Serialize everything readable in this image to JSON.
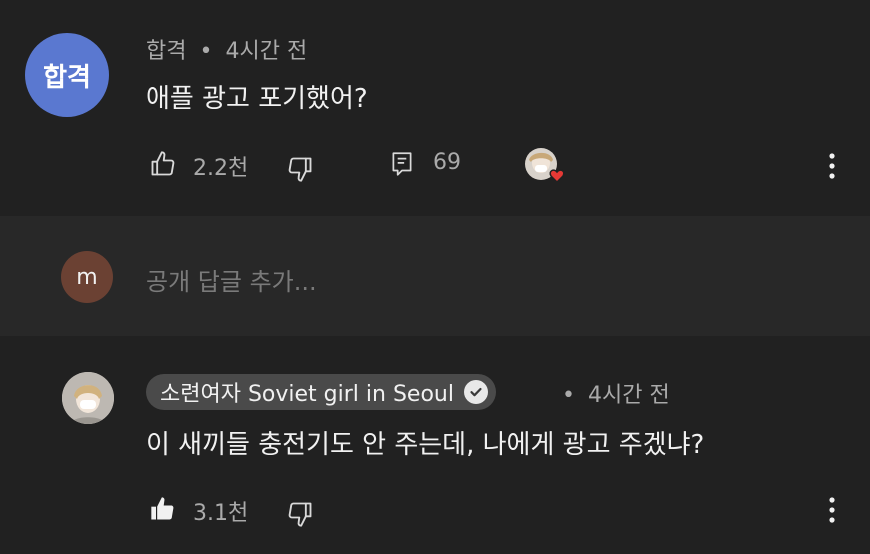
{
  "comment": {
    "avatar_text": "합격",
    "author": "합격",
    "separator": "•",
    "time": "4시간 전",
    "text": "애플 광고 포기했어?",
    "likes": "2.2천",
    "replies": "69",
    "icons": {
      "like": "thumbs-up-outline-icon",
      "dislike": "thumbs-down-outline-icon",
      "reply": "reply-comment-icon",
      "creator_heart": "creator-heart-icon",
      "more": "more-vertical-icon"
    }
  },
  "reply_box": {
    "avatar_letter": "m",
    "placeholder": "공개 답글 추가..."
  },
  "reply": {
    "author": "소련여자 Soviet girl in Seoul",
    "separator": "•",
    "time": "4시간 전",
    "text": "이 새끼들 충전기도 안 주는데, 나에게 광고 주겠냐?",
    "likes": "3.1천",
    "icons": {
      "like": "thumbs-up-filled-icon",
      "dislike": "thumbs-down-outline-icon",
      "verified": "verified-check-icon",
      "more": "more-vertical-icon"
    }
  },
  "colors": {
    "background": "#212121",
    "reply_box_bg": "#282828",
    "avatar_blue": "#5a78d0",
    "avatar_brown": "#6b4133",
    "heart": "#e53935"
  }
}
